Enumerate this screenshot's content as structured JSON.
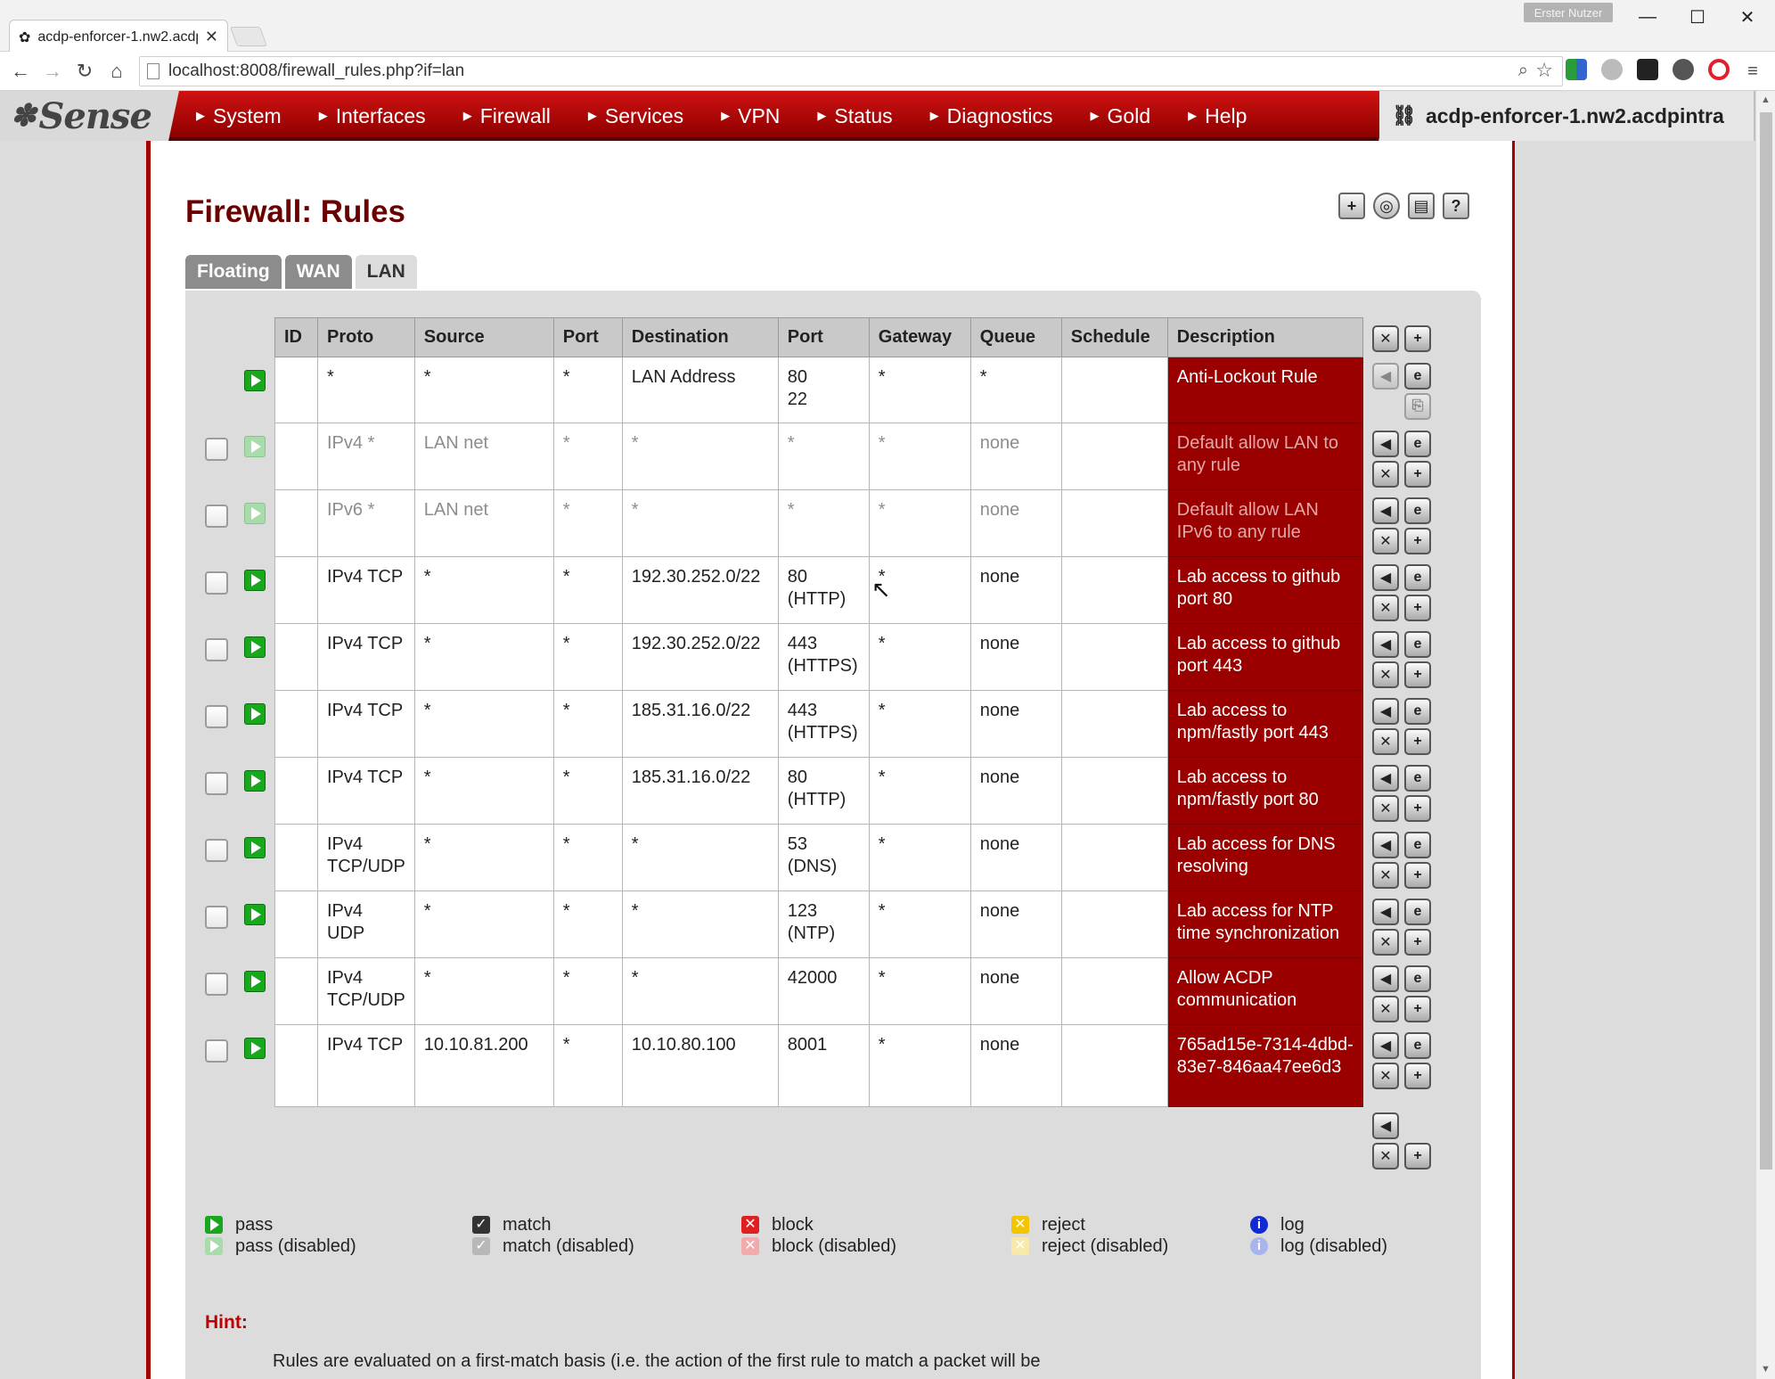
{
  "browser": {
    "tab_title": "acdp-enforcer-1.nw2.acdp",
    "user_badge": "Erster Nutzer",
    "url": "localhost:8008/firewall_rules.php?if=lan"
  },
  "header": {
    "logo": "Sense",
    "hostname": "acdp-enforcer-1.nw2.acdpintra",
    "menu": [
      "System",
      "Interfaces",
      "Firewall",
      "Services",
      "VPN",
      "Status",
      "Diagnostics",
      "Gold",
      "Help"
    ]
  },
  "page": {
    "title": "Firewall: Rules",
    "tabs": [
      {
        "label": "Floating",
        "active": false
      },
      {
        "label": "WAN",
        "active": false
      },
      {
        "label": "LAN",
        "active": true
      }
    ]
  },
  "table": {
    "headers": [
      "ID",
      "Proto",
      "Source",
      "Port",
      "Destination",
      "Port",
      "Gateway",
      "Queue",
      "Schedule",
      "Description"
    ],
    "rows": [
      {
        "id": "",
        "proto": "*",
        "source": "*",
        "sport": "*",
        "dest": "LAN Address",
        "dport": "80\n22",
        "gateway": "*",
        "queue": "*",
        "schedule": "",
        "desc": "Anti-Lockout Rule",
        "disabled": false,
        "lockout": true
      },
      {
        "id": "",
        "proto": "IPv4 *",
        "source": "LAN net",
        "sport": "*",
        "dest": "*",
        "dport": "*",
        "gateway": "*",
        "queue": "none",
        "schedule": "",
        "desc": "Default allow LAN to any rule",
        "disabled": true
      },
      {
        "id": "",
        "proto": "IPv6 *",
        "source": "LAN net",
        "sport": "*",
        "dest": "*",
        "dport": "*",
        "gateway": "*",
        "queue": "none",
        "schedule": "",
        "desc": "Default allow LAN IPv6 to any rule",
        "disabled": true
      },
      {
        "id": "",
        "proto": "IPv4 TCP",
        "source": "*",
        "sport": "*",
        "dest": "192.30.252.0/22",
        "dport": "80\n(HTTP)",
        "gateway": "*",
        "queue": "none",
        "schedule": "",
        "desc": "Lab access to github port 80",
        "disabled": false
      },
      {
        "id": "",
        "proto": "IPv4 TCP",
        "source": "*",
        "sport": "*",
        "dest": "192.30.252.0/22",
        "dport": "443\n(HTTPS)",
        "gateway": "*",
        "queue": "none",
        "schedule": "",
        "desc": "Lab access to github port 443",
        "disabled": false
      },
      {
        "id": "",
        "proto": "IPv4 TCP",
        "source": "*",
        "sport": "*",
        "dest": "185.31.16.0/22",
        "dport": "443\n(HTTPS)",
        "gateway": "*",
        "queue": "none",
        "schedule": "",
        "desc": "Lab access to npm/fastly port 443",
        "disabled": false
      },
      {
        "id": "",
        "proto": "IPv4 TCP",
        "source": "*",
        "sport": "*",
        "dest": "185.31.16.0/22",
        "dport": "80\n(HTTP)",
        "gateway": "*",
        "queue": "none",
        "schedule": "",
        "desc": "Lab access to npm/fastly port 80",
        "disabled": false
      },
      {
        "id": "",
        "proto": "IPv4\nTCP/UDP",
        "source": "*",
        "sport": "*",
        "dest": "*",
        "dport": "53\n(DNS)",
        "gateway": "*",
        "queue": "none",
        "schedule": "",
        "desc": "Lab access for DNS resolving",
        "disabled": false
      },
      {
        "id": "",
        "proto": "IPv4\nUDP",
        "source": "*",
        "sport": "*",
        "dest": "*",
        "dport": "123\n(NTP)",
        "gateway": "*",
        "queue": "none",
        "schedule": "",
        "desc": "Lab access for NTP time synchronization",
        "disabled": false
      },
      {
        "id": "",
        "proto": "IPv4\nTCP/UDP",
        "source": "*",
        "sport": "*",
        "dest": "*",
        "dport": "42000",
        "gateway": "*",
        "queue": "none",
        "schedule": "",
        "desc": "Allow ACDP communication",
        "disabled": false
      },
      {
        "id": "",
        "proto": "IPv4 TCP",
        "source": "10.10.81.200",
        "sport": "*",
        "dest": "10.10.80.100",
        "dport": "8001",
        "gateway": "*",
        "queue": "none",
        "schedule": "",
        "desc": "765ad15e-7314-4dbd-83e7-846aa47ee6d3",
        "disabled": false
      }
    ]
  },
  "legend": [
    {
      "kind": "pass",
      "label": "pass",
      "dlabel": "pass (disabled)"
    },
    {
      "kind": "match",
      "label": "match",
      "dlabel": "match (disabled)"
    },
    {
      "kind": "block",
      "label": "block",
      "dlabel": "block (disabled)"
    },
    {
      "kind": "reject",
      "label": "reject",
      "dlabel": "reject (disabled)"
    },
    {
      "kind": "log",
      "label": "log",
      "dlabel": "log (disabled)"
    }
  ],
  "hint": {
    "title": "Hint:",
    "text": "Rules are evaluated on a first-match basis (i.e. the action of the first rule to match a packet will be"
  },
  "colors": {
    "menu_red": "#b80000",
    "desc_red": "#9a0000",
    "pass_green": "#17a81b",
    "title_red": "#6b0000"
  }
}
